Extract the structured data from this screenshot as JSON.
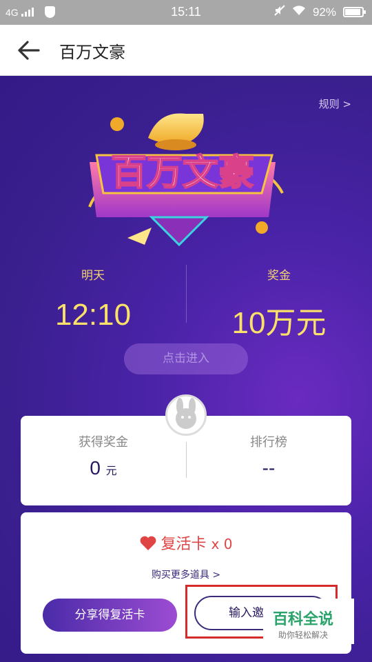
{
  "status": {
    "network": "4G",
    "time": "15:11",
    "battery": "92%"
  },
  "nav": {
    "title": "百万文豪"
  },
  "rules": "规则 >",
  "logo_text": "百万文豪",
  "schedule": {
    "label": "明天",
    "value": "12:10"
  },
  "prize": {
    "label": "奖金",
    "value": "10万元"
  },
  "enter_button": "点击进入",
  "stats": {
    "earned_label": "获得奖金",
    "earned_value": "0",
    "earned_unit": "元",
    "rank_label": "排行榜",
    "rank_value": "--"
  },
  "revive": {
    "label": "复活卡",
    "count": "x 0"
  },
  "buy_more": "购买更多道具 >",
  "share_button": "分享得复活卡",
  "invite_button": "输入邀",
  "watermark": {
    "title": "百科全说",
    "subtitle": "助你轻松解决"
  },
  "colors": {
    "accent": "#fbe16a",
    "purple": "#3a1f8f",
    "red": "#e04545"
  }
}
